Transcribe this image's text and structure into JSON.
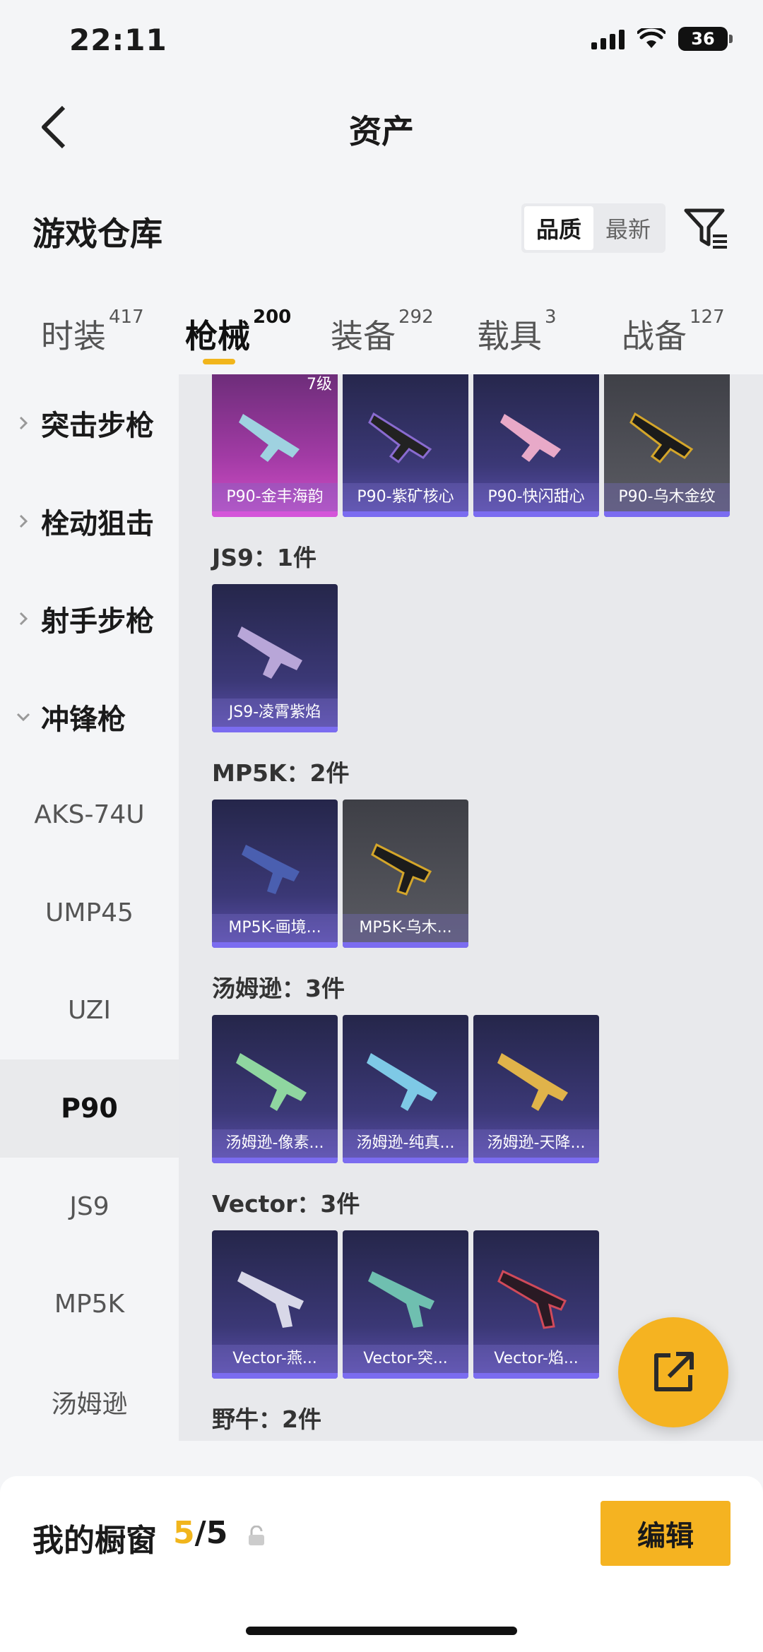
{
  "status": {
    "time": "22:11",
    "battery": "36"
  },
  "header": {
    "title": "资产"
  },
  "section": {
    "title": "游戏仓库",
    "sort_options": [
      "品质",
      "最新"
    ]
  },
  "tabs": [
    {
      "label": "时装",
      "count": "417"
    },
    {
      "label": "枪械",
      "count": "200"
    },
    {
      "label": "装备",
      "count": "292"
    },
    {
      "label": "载具",
      "count": "3"
    },
    {
      "label": "战备",
      "count": "127"
    }
  ],
  "sidebar": {
    "categories": [
      "突击步枪",
      "栓动狙击",
      "射手步枪",
      "冲锋枪"
    ],
    "subitems": [
      "AKS-74U",
      "UMP45",
      "UZI",
      "P90",
      "JS9",
      "MP5K",
      "汤姆逊"
    ]
  },
  "content": {
    "p90_items": [
      "P90-金丰海韵",
      "P90-紫矿核心",
      "P90-快闪甜心",
      "P90-乌木金纹"
    ],
    "p90_level": "7级",
    "js9": {
      "label": "JS9：1件",
      "items": [
        "JS9-凌霄紫焰"
      ]
    },
    "mp5k": {
      "label": "MP5K：2件",
      "items": [
        "MP5K-画境...",
        "MP5K-乌木..."
      ]
    },
    "thompson": {
      "label": "汤姆逊：3件",
      "items": [
        "汤姆逊-像素...",
        "汤姆逊-纯真...",
        "汤姆逊-天降..."
      ]
    },
    "vector": {
      "label": "Vector：3件",
      "items": [
        "Vector-燕...",
        "Vector-突...",
        "Vector-焰..."
      ]
    },
    "bison": {
      "label": "野牛：2件"
    }
  },
  "bottom": {
    "showcase_label": "我的橱窗",
    "current": "5",
    "total": "/5",
    "edit_label": "编辑"
  },
  "colors": {
    "accent": "#f5b321",
    "card_purple": "#3b3876",
    "card_pink": "#a23ba5"
  }
}
